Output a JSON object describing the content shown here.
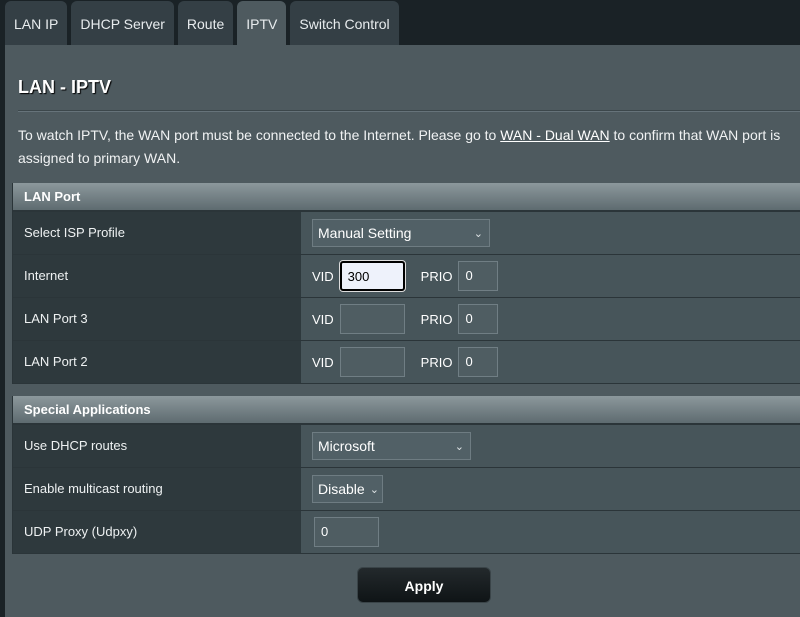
{
  "tabs": [
    "LAN IP",
    "DHCP Server",
    "Route",
    "IPTV",
    "Switch Control"
  ],
  "title": "LAN - IPTV",
  "description": {
    "before": "To watch IPTV, the WAN port must be connected to the Internet. Please go to ",
    "link": "WAN - Dual WAN",
    "after": " to confirm that WAN port is assigned to primary WAN."
  },
  "lan_port": {
    "header": "LAN Port",
    "isp_label": "Select ISP Profile",
    "isp_value": "Manual Setting",
    "vid_label": "VID",
    "prio_label": "PRIO",
    "rows": [
      {
        "label": "Internet",
        "vid": "300",
        "prio": "0"
      },
      {
        "label": "LAN Port 3",
        "vid": "",
        "prio": "0"
      },
      {
        "label": "LAN Port 2",
        "vid": "",
        "prio": "0"
      }
    ]
  },
  "special": {
    "header": "Special Applications",
    "dhcp_label": "Use DHCP routes",
    "dhcp_value": "Microsoft",
    "mcast_label": "Enable multicast routing",
    "mcast_value": "Disable",
    "udpxy_label": "UDP Proxy (Udpxy)",
    "udpxy_value": "0"
  },
  "apply": "Apply"
}
